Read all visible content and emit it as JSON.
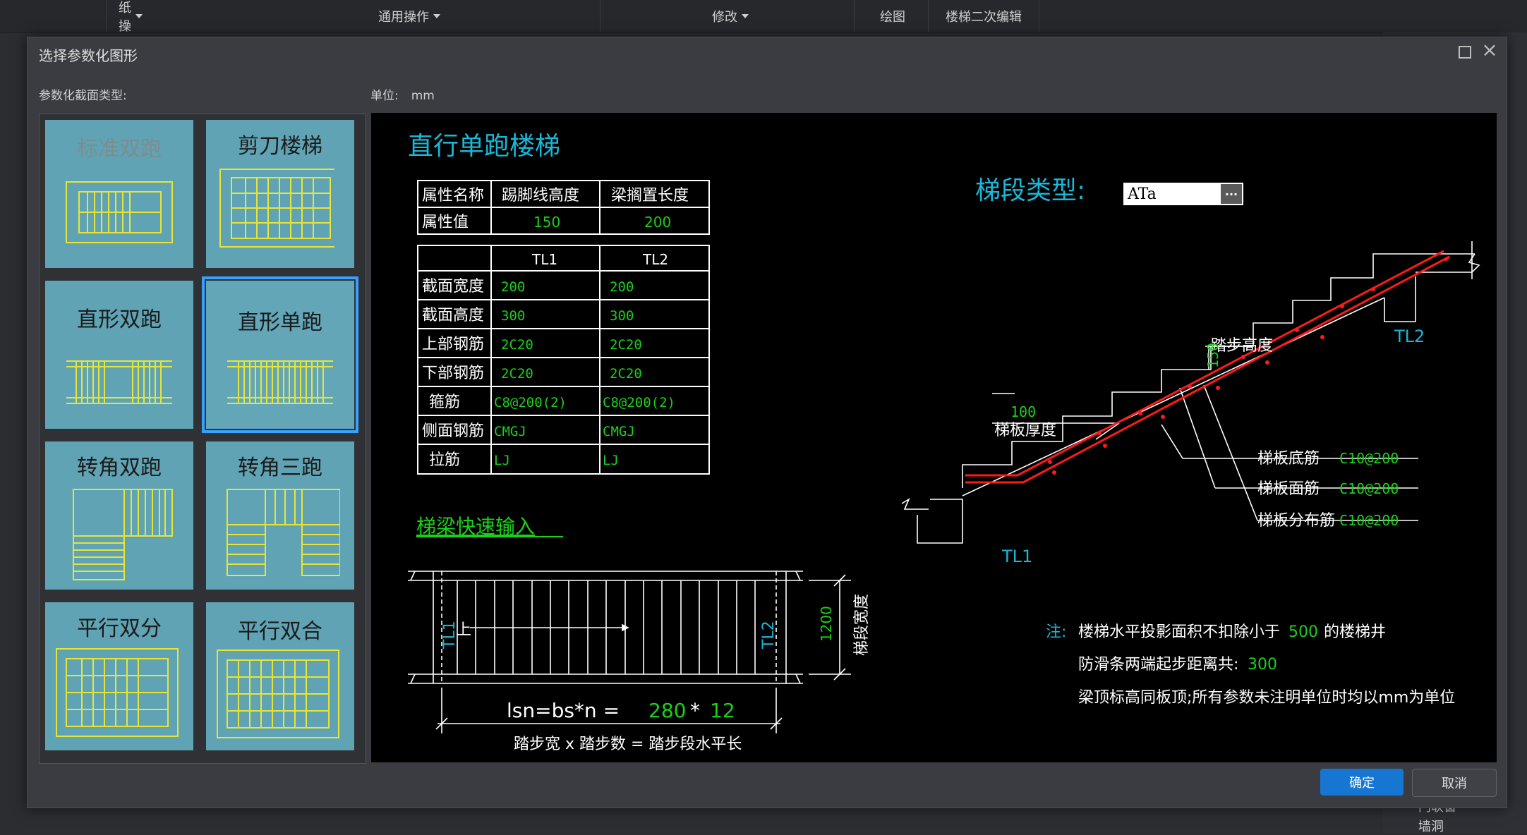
{
  "toolbar": {
    "groups": [
      "图纸操作",
      "通用操作",
      "修改",
      "绘图",
      "楼梯二次编辑"
    ]
  },
  "background": {
    "bottom_items": [
      "门联窗",
      "墙洞"
    ]
  },
  "dialog": {
    "title": "选择参数化图形",
    "section_label": "参数化截面类型:",
    "unit_label": "单位:",
    "unit_value": "mm",
    "ok": "确定",
    "cancel": "取消"
  },
  "thumbnails": [
    {
      "label": "标准双跑",
      "icon": "standard-double-run-icon"
    },
    {
      "label": "剪刀楼梯",
      "icon": "scissor-stair-icon"
    },
    {
      "label": "直形双跑",
      "icon": "straight-double-run-icon"
    },
    {
      "label": "直形单跑",
      "icon": "straight-single-run-icon",
      "selected": true
    },
    {
      "label": "转角双跑",
      "icon": "corner-double-run-icon"
    },
    {
      "label": "转角三跑",
      "icon": "corner-triple-run-icon"
    },
    {
      "label": "平行双分",
      "icon": "parallel-double-split-icon"
    },
    {
      "label": "平行双合",
      "icon": "parallel-double-merge-icon"
    }
  ],
  "drawing": {
    "title": "直行单跑楼梯",
    "props_table": {
      "header": [
        "属性名称",
        "踢脚线高度",
        "梁搁置长度"
      ],
      "row": [
        "属性值",
        "150",
        "200"
      ]
    },
    "beam_table": {
      "columns": [
        "",
        "TL1",
        "TL2"
      ],
      "rows": [
        [
          "截面宽度",
          "200",
          "200"
        ],
        [
          "截面高度",
          "300",
          "300"
        ],
        [
          "上部钢筋",
          "2C20",
          "2C20"
        ],
        [
          "下部钢筋",
          "2C20",
          "2C20"
        ],
        [
          "箍筋",
          "C8@200(2)",
          "C8@200(2)"
        ],
        [
          "侧面钢筋",
          "CMGJ",
          "CMGJ"
        ],
        [
          "拉筋",
          "LJ",
          "LJ"
        ]
      ]
    },
    "quick_input": "梯梁快速输入",
    "segment_type_label": "梯段类型:",
    "segment_type_value": "ATa",
    "segment_more": "···",
    "section_labels": {
      "step_height": "踏步高度",
      "step_height_val": "150",
      "slab_thickness_val": "100",
      "slab_thickness": "梯板厚度",
      "tl1": "TL1",
      "tl2": "TL2",
      "bottom_bar": "梯板底筋",
      "bottom_bar_val": "C10@200",
      "top_bar": "梯板面筋",
      "top_bar_val": "C10@200",
      "dist_bar": "梯板分布筋",
      "dist_bar_val": "C10@200"
    },
    "plan_labels": {
      "tl1": "TL1",
      "tl2": "TL2",
      "up": "上",
      "width_val": "1200",
      "width_label": "梯段宽度",
      "formula_prefix": "lsn=bs*n =",
      "formula_bs": "280",
      "formula_op": "*",
      "formula_n": "12",
      "formula_caption": "踏步宽 x 踏步数 = 踏步段水平长"
    },
    "notes": {
      "prefix": "注:",
      "line1_a": "楼梯水平投影面积不扣除小于",
      "line1_val": "500",
      "line1_b": "的楼梯井",
      "line2_a": "防滑条两端起步距离共:",
      "line2_val": "300",
      "line3": "梁顶标高同板顶;所有参数未注明单位时均以mm为单位"
    }
  },
  "colors": {
    "cyan": "#18b8d8",
    "green": "#19d119",
    "red": "#ff1a1a",
    "accent": "#1677d2"
  }
}
